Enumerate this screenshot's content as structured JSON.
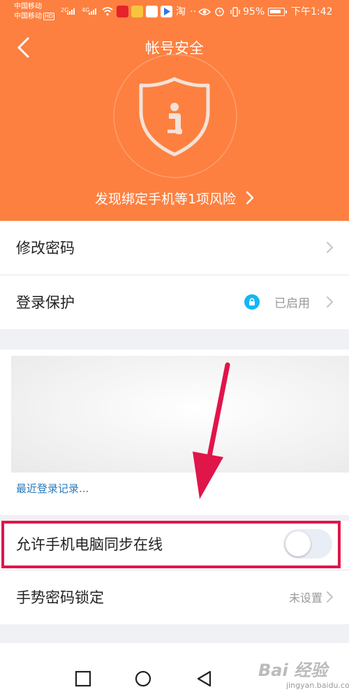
{
  "status_bar": {
    "carrier1": "中国移动",
    "carrier2": "中国移动",
    "hd_label": "HD",
    "net1": "2G",
    "net2": "4G",
    "taobao": "淘",
    "battery": "95%",
    "time": "下午1:42"
  },
  "header": {
    "title": "帐号安全",
    "risk_text": "发现绑定手机等1项风险",
    "bg_color": "#fd8040"
  },
  "settings": {
    "change_password": "修改密码",
    "login_protection": "登录保护",
    "login_protection_status": "已启用",
    "recent_login": "最近登录记录...",
    "allow_sync_online": "允许手机电脑同步在线",
    "allow_sync_enabled": false,
    "gesture_lock": "手势密码锁定",
    "gesture_lock_status": "未设置"
  },
  "icons": {
    "back": "chevron-left-icon",
    "shield": "shield-info-icon",
    "lock": "lock-icon",
    "nav": [
      "square-icon",
      "circle-icon",
      "triangle-back-icon"
    ]
  },
  "annotation": {
    "color": "#e0154a"
  },
  "watermark": {
    "main": "Bai 经验",
    "sub": "jingyan.baidu.com"
  }
}
